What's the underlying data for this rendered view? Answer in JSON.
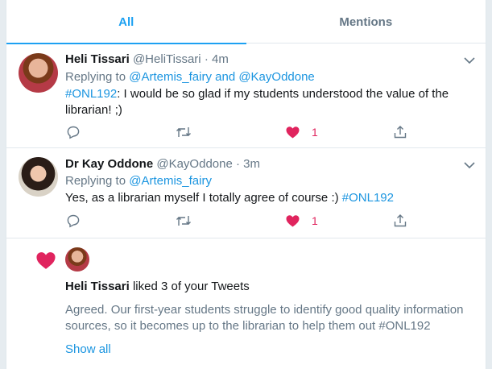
{
  "tabs": [
    {
      "label": "All"
    },
    {
      "label": "Mentions"
    }
  ],
  "tweets": [
    {
      "name": "Heli Tissari",
      "handle": "@HeliTissari",
      "time": "4m",
      "replying_prefix": "Replying to ",
      "replying_to": "@Artemis_fairy and @KayOddone",
      "hashtag": "#ONL192",
      "text": ": I would be so glad if my students understood the value of the librarian! ;)",
      "likes": "1"
    },
    {
      "name": "Dr Kay Oddone",
      "handle": "@KayOddone",
      "time": "3m",
      "replying_prefix": "Replying to ",
      "replying_to": "@Artemis_fairy",
      "text": "Yes, as a librarian myself I totally agree of course :) ",
      "hashtag": "#ONL192",
      "likes": "1"
    }
  ],
  "notification": {
    "actor": "Heli Tissari",
    "action": " liked 3 of your Tweets",
    "preview": "Agreed. Our first-year students struggle to identify good quality information sources, so it becomes up to the librarian to help them out #ONL192",
    "show_all": "Show all"
  },
  "colors": {
    "accent": "#1da1f2",
    "link": "#1b95e0",
    "like": "#e0245e",
    "muted": "#657786",
    "border": "#e1e8ed"
  }
}
